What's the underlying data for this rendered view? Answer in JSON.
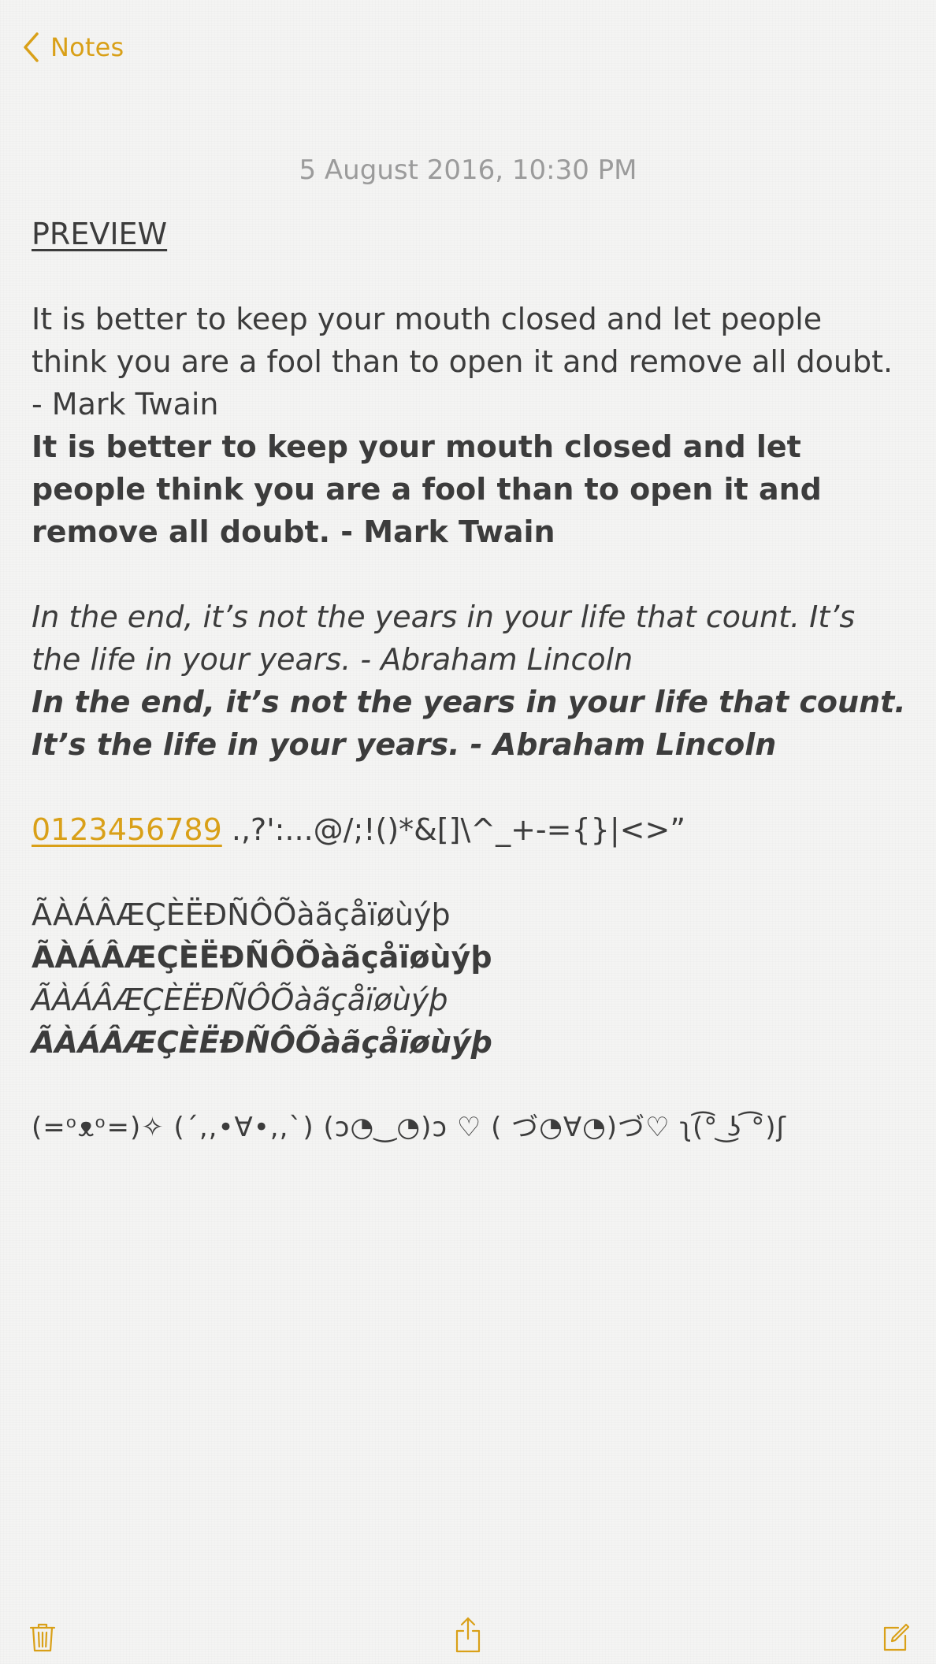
{
  "nav": {
    "back_label": "Notes",
    "back_icon": "chevron-left-icon",
    "accent_color": "#d9a018"
  },
  "note": {
    "date": "5 August 2016, 10:30 PM",
    "heading": "PREVIEW",
    "quote1_regular": "It is better to keep your mouth closed and let people think you are a fool than to open it and remove all doubt. - Mark Twain",
    "quote1_bold": "It is better to keep your mouth closed and let people think you are a fool than to open it and remove all doubt. - Mark Twain",
    "quote2_italic": "In the end, it’s not the years in your life that count. It’s the life in your years. - Abraham Lincoln",
    "quote2_bold_italic": "In the end, it’s not the years in your life that count. It’s the life in your years. - Abraham Lincoln",
    "digits_link": "0123456789",
    "punctuation": " .,?':...@/;!()*&[]\\^_+-={}|<>”",
    "accents_regular": "ÃÀÁÂÆÇÈËÐÑÔÕàãçåïøùýþ",
    "accents_bold": "ÃÀÁÂÆÇÈËÐÑÔÕàãçåïøùýþ",
    "accents_italic": "ÃÀÁÂÆÇÈËÐÑÔÕàãçåïøùýþ",
    "accents_bold_italic": "ÃÀÁÂÆÇÈËÐÑÔÕàãçåïøùýþ",
    "kaomoji": "(=ᵒᴥᵒ=)✧  (´,,•∀•,,`)  (ɔ◔‿◔)ɔ ♡  ( づ◔∀◔)づ♡  ʅ(͡° ͜ʖ ͡°)ʃ"
  },
  "toolbar": {
    "delete_icon": "trash-icon",
    "share_icon": "share-icon",
    "compose_icon": "compose-icon"
  }
}
